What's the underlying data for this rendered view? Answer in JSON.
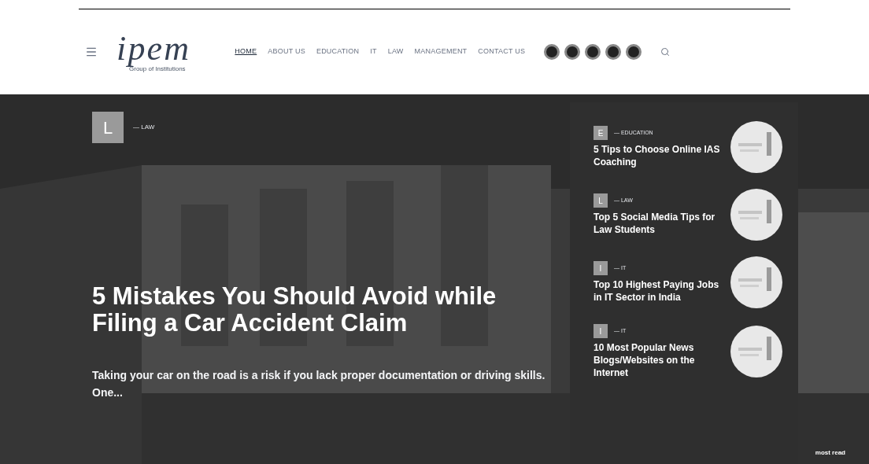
{
  "header": {
    "logo": "ipem",
    "logo_tagline": "Group of Institutions",
    "nav": [
      {
        "label": "HOME",
        "selected": true
      },
      {
        "label": "ABOUT US",
        "selected": false
      },
      {
        "label": "EDUCATION",
        "selected": false
      },
      {
        "label": "IT",
        "selected": false
      },
      {
        "label": "LAW",
        "selected": false
      },
      {
        "label": "MANAGEMENT",
        "selected": false
      },
      {
        "label": "CONTACT US",
        "selected": false
      }
    ],
    "social": [
      {
        "kind": "circle"
      },
      {
        "kind": "circle"
      },
      {
        "kind": "circle"
      },
      {
        "kind": "circle"
      },
      {
        "kind": "circle"
      }
    ]
  },
  "hero": {
    "badge": "L",
    "category": "— LAW",
    "title": "5 Mistakes You Should Avoid while Filing a Car Accident Claim",
    "excerpt": "Taking your car on the road is a risk if you lack proper documentation or driving skills. One..."
  },
  "side_posts": [
    {
      "badge": "E",
      "category": "— EDUCATION",
      "title": "5 Tips to Choose Online IAS Coaching"
    },
    {
      "badge": "L",
      "category": "— LAW",
      "title": "Top 5 Social Media Tips for Law Students"
    },
    {
      "badge": "I",
      "category": "— IT",
      "title": "Top 10 Highest Paying Jobs in IT Sector in India"
    },
    {
      "badge": "I",
      "category": "— IT",
      "title": "10 Most Popular News Blogs/Websites on the Internet"
    }
  ],
  "footer_label": "most read"
}
